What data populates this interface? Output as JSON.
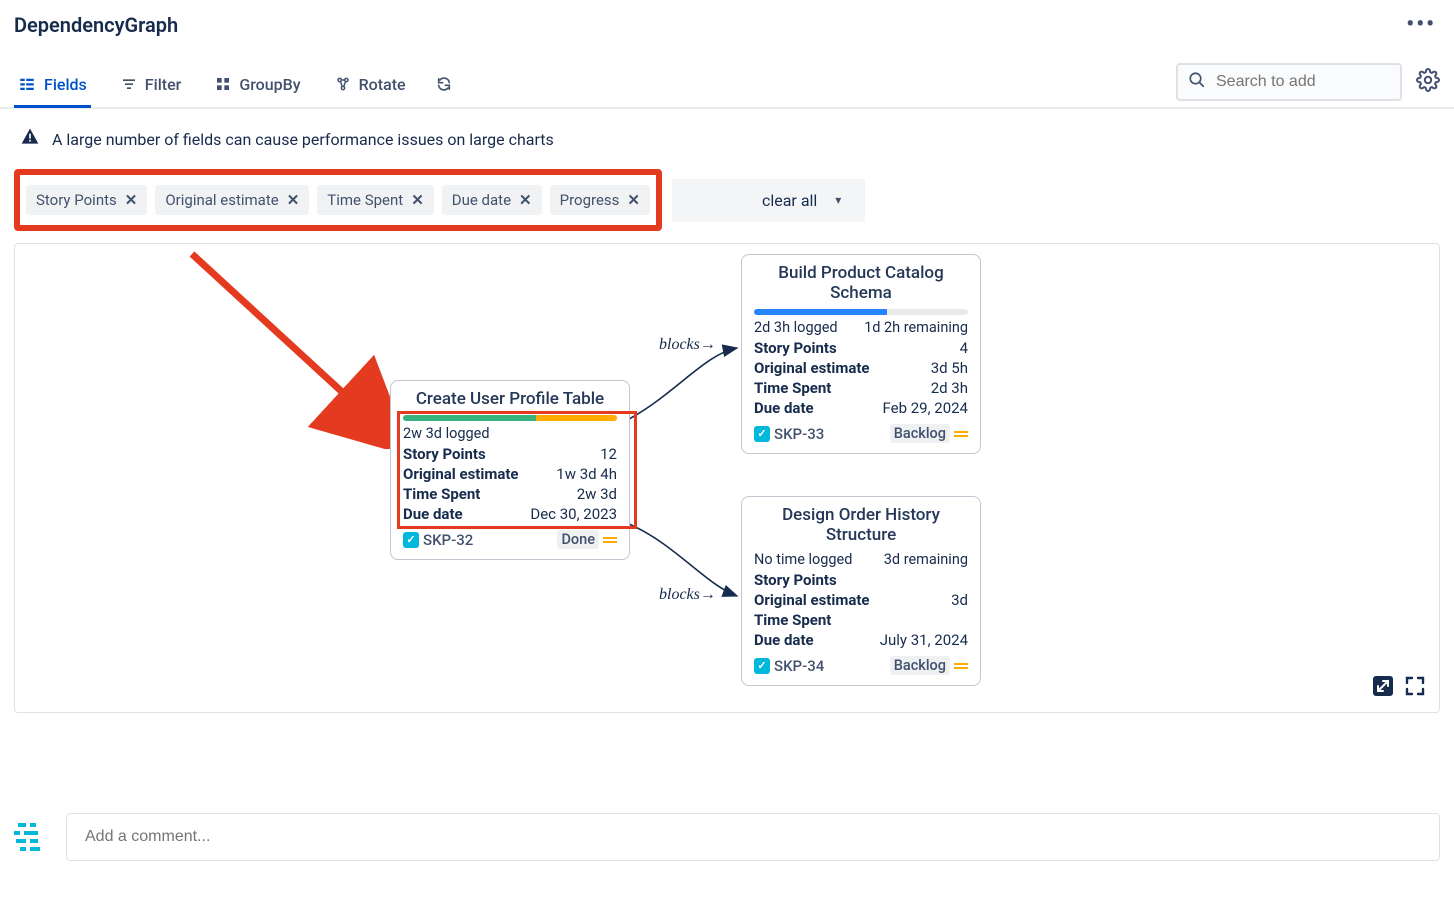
{
  "app": {
    "title": "DependencyGraph"
  },
  "tabs": {
    "fields": "Fields",
    "filter": "Filter",
    "groupby": "GroupBy",
    "rotate": "Rotate"
  },
  "search": {
    "placeholder": "Search to add"
  },
  "warning": "A large number of fields can cause performance issues on large charts",
  "chips": {
    "storyPoints": "Story Points",
    "originalEstimate": "Original estimate",
    "timeSpent": "Time Spent",
    "dueDate": "Due date",
    "progress": "Progress"
  },
  "clearAll": "clear all",
  "edges": {
    "blocks1": "blocks",
    "blocks2": "blocks"
  },
  "cards": {
    "center": {
      "title": "Create User Profile Table",
      "logged": "2w 3d logged",
      "remaining": "",
      "fields": {
        "storyPoints": {
          "lbl": "Story Points",
          "val": "12"
        },
        "originalEstimate": {
          "lbl": "Original estimate",
          "val": "1w 3d 4h"
        },
        "timeSpent": {
          "lbl": "Time Spent",
          "val": "2w 3d"
        },
        "dueDate": {
          "lbl": "Due date",
          "val": "Dec 30, 2023"
        }
      },
      "key": "SKP-32",
      "status": "Done"
    },
    "top": {
      "title": "Build Product Catalog Schema",
      "logged": "2d 3h logged",
      "remaining": "1d 2h remaining",
      "fields": {
        "storyPoints": {
          "lbl": "Story Points",
          "val": "4"
        },
        "originalEstimate": {
          "lbl": "Original estimate",
          "val": "3d 5h"
        },
        "timeSpent": {
          "lbl": "Time Spent",
          "val": "2d 3h"
        },
        "dueDate": {
          "lbl": "Due date",
          "val": "Feb 29, 2024"
        }
      },
      "key": "SKP-33",
      "status": "Backlog"
    },
    "bottom": {
      "title": "Design Order History Structure",
      "logged": "No time logged",
      "remaining": "3d remaining",
      "fields": {
        "storyPoints": {
          "lbl": "Story Points",
          "val": ""
        },
        "originalEstimate": {
          "lbl": "Original estimate",
          "val": "3d"
        },
        "timeSpent": {
          "lbl": "Time Spent",
          "val": ""
        },
        "dueDate": {
          "lbl": "Due date",
          "val": "July 31, 2024"
        }
      },
      "key": "SKP-34",
      "status": "Backlog"
    }
  },
  "comment": {
    "placeholder": "Add a comment..."
  }
}
